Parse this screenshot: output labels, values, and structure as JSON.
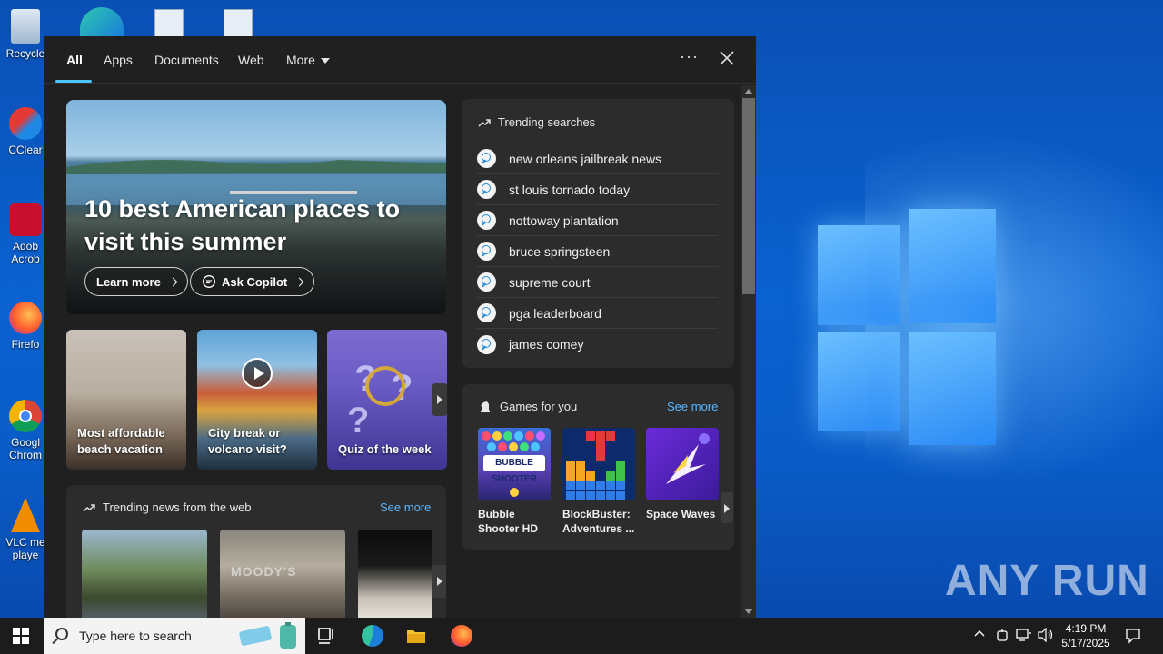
{
  "desktop": {
    "icons": [
      {
        "label": "Recycle"
      },
      {
        "label": "CClear"
      },
      {
        "label": "Adob\nAcrob"
      },
      {
        "label": "Firefo"
      },
      {
        "label": "Googl\nChrom"
      },
      {
        "label": "VLC me\nplaye"
      }
    ],
    "watermark": "ANY RUN"
  },
  "search_panel": {
    "tabs": [
      {
        "label": "All",
        "active": true
      },
      {
        "label": "Apps"
      },
      {
        "label": "Documents"
      },
      {
        "label": "Web"
      },
      {
        "label": "More"
      }
    ],
    "more_options": "···",
    "hero": {
      "title": "10 best American places to visit this summer",
      "learn_more": "Learn more",
      "ask_copilot": "Ask Copilot"
    },
    "cards": [
      {
        "label": "Most affordable beach vacation"
      },
      {
        "label": "City break or volcano visit?"
      },
      {
        "label": "Quiz of the week"
      }
    ],
    "trending_news": {
      "title": "Trending news from the web",
      "see_more": "See more",
      "moodys_sign": "MOODY'S"
    },
    "trending_searches": {
      "title": "Trending searches",
      "items": [
        "new orleans jailbreak news",
        "st louis tornado today",
        "nottoway plantation",
        "bruce springsteen",
        "supreme court",
        "pga leaderboard",
        "james comey"
      ]
    },
    "games": {
      "title": "Games for you",
      "see_more": "See more",
      "items": [
        {
          "name": "Bubble Shooter HD",
          "logo_text": "BUBBLE SHOOTER"
        },
        {
          "name": "BlockBuster: Adventures ..."
        },
        {
          "name": "Space Waves"
        }
      ]
    }
  },
  "taskbar": {
    "search_placeholder": "Type here to search",
    "time": "4:19 PM",
    "date": "5/17/2025"
  },
  "colors": {
    "accent": "#4cc2ff",
    "link": "#5cb8ff",
    "panel_bg": "#202020",
    "card_bg": "#2c2c2c",
    "taskbar_bg": "#1c1c1c"
  }
}
